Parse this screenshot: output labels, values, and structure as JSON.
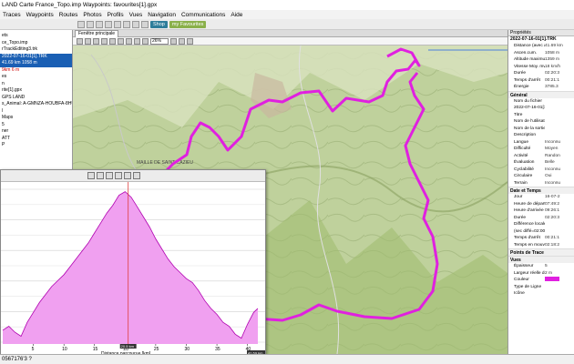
{
  "window": {
    "title": "LAND Carte France_Topo.imp Waypoints: favourites[1].gpx"
  },
  "menu": [
    "Traces",
    "Waypoints",
    "Routes",
    "Photos",
    "Profils",
    "Vues",
    "Navigation",
    "Communications",
    "Aide"
  ],
  "toolbar": {
    "shop_label": "Shop",
    "favourites_label": "my Favourites",
    "zoom_value": "26%"
  },
  "map_tab": {
    "label": "Fenêtre principale"
  },
  "tree": [
    {
      "label": "ets",
      "style": "normal"
    },
    {
      "label": "ce_Topo.imp",
      "style": "normal"
    },
    {
      "label": "rTrackEditing3.trk",
      "style": "normal"
    },
    {
      "label": "2022-07-16-01[1].TRK",
      "style": "sel"
    },
    {
      "label": "41.69 km  1058 m",
      "style": "sel"
    },
    {
      "label": "9km    6 m",
      "style": "sub"
    },
    {
      "label": "es",
      "style": "normal"
    },
    {
      "label": "n",
      "style": "normal"
    },
    {
      "label": "rite[1].gpx",
      "style": "normal"
    },
    {
      "label": "GPS LAND",
      "style": "normal"
    },
    {
      "label": "s_Animal: A-GMNZA-HOUBFA-8HUB",
      "style": "normal"
    },
    {
      "label": "l",
      "style": "normal"
    },
    {
      "label": "Maps",
      "style": "normal"
    },
    {
      "label": "5",
      "style": "normal"
    },
    {
      "label": "ner",
      "style": "normal"
    },
    {
      "label": "ATT",
      "style": "normal"
    },
    {
      "label": "P",
      "style": "normal"
    }
  ],
  "profile": {
    "axis_label": "Distance parcourue [km]",
    "cursor_label": "20.5 km",
    "cursor_distance_km": 20.5,
    "ticks": [
      "5",
      "10",
      "15",
      "20",
      "25",
      "30",
      "35",
      "40"
    ],
    "tick_values": [
      5,
      10,
      15,
      20,
      25,
      30,
      35,
      40
    ],
    "end_label": "41.69 km",
    "x_max_km": 41.69,
    "x_min_km": 0,
    "elevation_max": 1070,
    "elevation_min": 300,
    "elevation_points": [
      [
        0,
        360
      ],
      [
        1,
        380
      ],
      [
        2,
        350
      ],
      [
        3,
        330
      ],
      [
        4,
        400
      ],
      [
        5,
        450
      ],
      [
        6,
        500
      ],
      [
        7,
        540
      ],
      [
        8,
        580
      ],
      [
        9,
        610
      ],
      [
        10,
        640
      ],
      [
        11,
        680
      ],
      [
        12,
        720
      ],
      [
        13,
        760
      ],
      [
        14,
        800
      ],
      [
        15,
        850
      ],
      [
        16,
        900
      ],
      [
        17,
        950
      ],
      [
        18,
        990
      ],
      [
        19,
        1040
      ],
      [
        20,
        1058
      ],
      [
        21,
        1030
      ],
      [
        22,
        980
      ],
      [
        23,
        930
      ],
      [
        24,
        880
      ],
      [
        25,
        820
      ],
      [
        26,
        770
      ],
      [
        27,
        720
      ],
      [
        28,
        680
      ],
      [
        29,
        650
      ],
      [
        30,
        620
      ],
      [
        31,
        600
      ],
      [
        32,
        560
      ],
      [
        33,
        510
      ],
      [
        34,
        470
      ],
      [
        35,
        440
      ],
      [
        36,
        400
      ],
      [
        37,
        380
      ],
      [
        38,
        340
      ],
      [
        39,
        320
      ],
      [
        40,
        390
      ],
      [
        41,
        450
      ],
      [
        41.69,
        470
      ]
    ],
    "fill_color": "#f0a0f0",
    "line_color": "#b000b0"
  },
  "props": {
    "title": "Propriétés",
    "subtitle": "2022-07-16-01[1].TRK",
    "rows": [
      {
        "k": "Distance (avec altitud",
        "v": "41.69 km"
      },
      {
        "k": "Ascen.cum.",
        "v": "1058 m"
      },
      {
        "k": "Altitude maximum",
        "v": "1359 m"
      },
      {
        "k": "Vitesse Moy. mvt",
        "v": "18 km/h"
      },
      {
        "k": "Durée",
        "v": "02:20:3"
      },
      {
        "k": "Temps d'arrêt",
        "v": "00:21:1"
      },
      {
        "k": "Énergie",
        "v": "3785.3"
      }
    ],
    "section_general": "Général",
    "general_rows": [
      {
        "k": "Nom du fichier",
        "v": ""
      },
      {
        "k": "2022-07-16-01[1].TRK",
        "v": ""
      },
      {
        "k": "Titre",
        "v": ""
      },
      {
        "k": "Nom de l'utilisateur",
        "v": ""
      },
      {
        "k": "Nom de la sortie",
        "v": ""
      },
      {
        "k": "Description",
        "v": ""
      },
      {
        "k": "Langue",
        "v": "Inconnu"
      },
      {
        "k": "Difficulté",
        "v": "Moyen"
      },
      {
        "k": "Activité",
        "v": "Randon"
      },
      {
        "k": "Évaluation",
        "v": "Belle"
      },
      {
        "k": "Cyclabilité",
        "v": "Inconnu"
      },
      {
        "k": "Circulaire",
        "v": "Oui"
      },
      {
        "k": "Terrain",
        "v": "Inconnu"
      }
    ],
    "section_date": "Date et Temps",
    "date_rows": [
      {
        "k": "Jour",
        "v": "16-07-2"
      },
      {
        "k": "Heure de départ",
        "v": "07:49:2"
      },
      {
        "k": "Heure d'arrivée",
        "v": "09:26:1"
      },
      {
        "k": "Durée",
        "v": "02:20:3"
      },
      {
        "k": "Différence locale-UTC:",
        "v": ""
      },
      {
        "k": "(sec diffé=02:00:00)",
        "v": ""
      },
      {
        "k": "Temps d'arrêt",
        "v": "00:21:1"
      },
      {
        "k": "Temps en mouvemen",
        "v": "02:18:2"
      }
    ],
    "section_points": "Points de Trace",
    "section_vues": "Vues",
    "vue_rows": [
      {
        "k": "Épaisseur",
        "v": "5"
      },
      {
        "k": "Largeur réelle de la tr",
        "v": "2 m"
      },
      {
        "k": "Couleur",
        "v": ""
      },
      {
        "k": "Type de Ligne",
        "v": ""
      },
      {
        "k": "Icône",
        "v": ""
      }
    ]
  },
  "map": {
    "track_color": "#e020e0",
    "place_label_1": "MAILLE DE SAINT-CAZIEU"
  },
  "status": {
    "text": "0567176'3 ?"
  }
}
